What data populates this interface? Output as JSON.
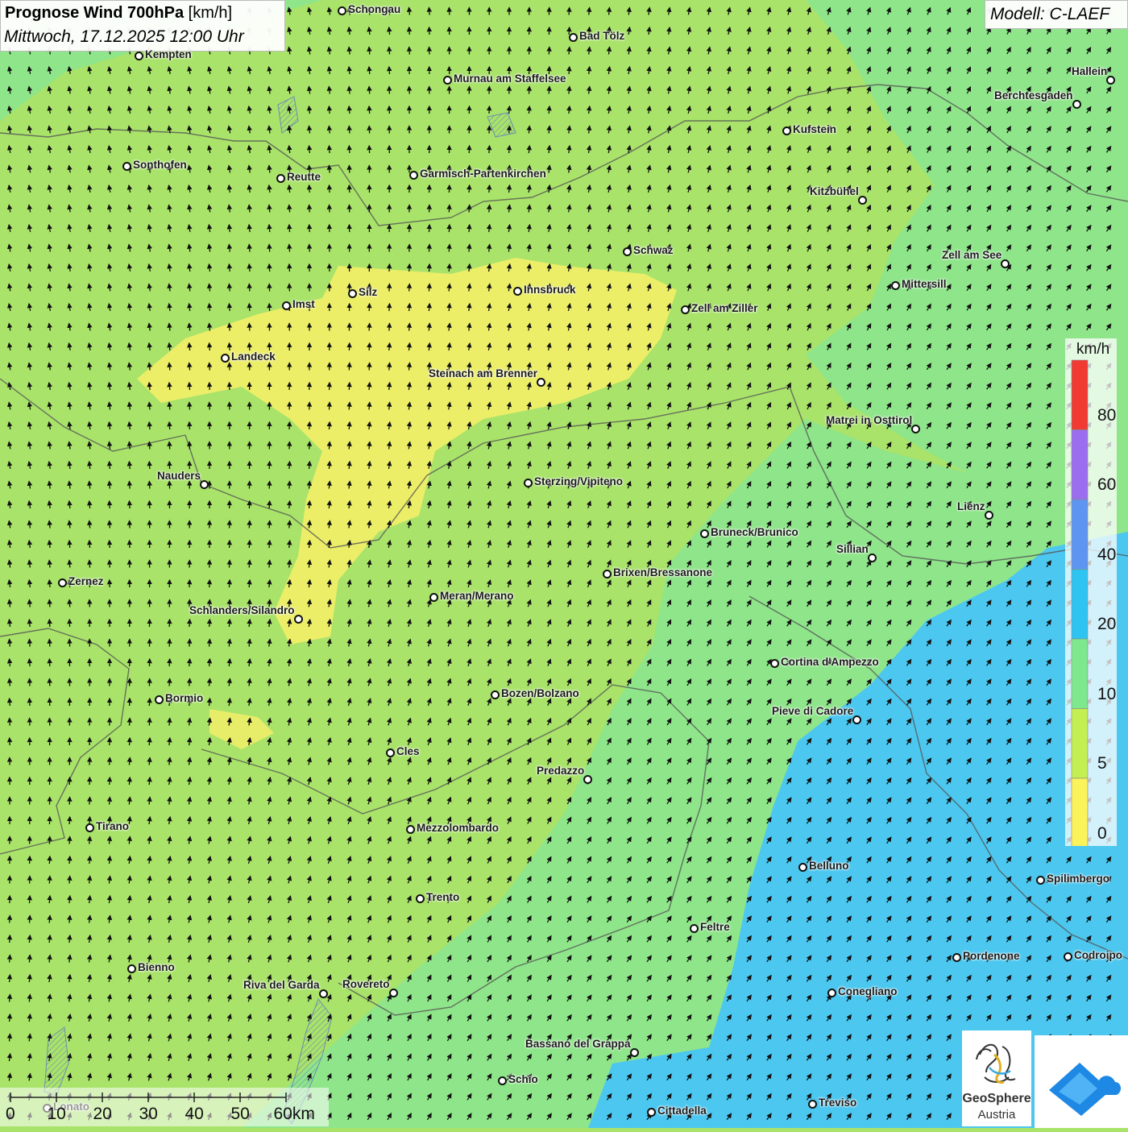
{
  "header": {
    "title_bold": "Prognose Wind 700hPa",
    "title_unit": "[km/h]",
    "subtitle": "Mittwoch, 17.12.2025 12:00 Uhr"
  },
  "model": {
    "label": "Modell: C-LAEF"
  },
  "legend": {
    "unit": "km/h",
    "labels": [
      "80",
      "60",
      "40",
      "20",
      "10",
      "5",
      "0"
    ],
    "colors": [
      "#f03a32",
      "#9b6ef0",
      "#5e95f2",
      "#2ec4f2",
      "#7de88e",
      "#c3ef52",
      "#fbf35a"
    ]
  },
  "scale_bar": {
    "labels": [
      "0",
      "10",
      "20",
      "30",
      "40",
      "50",
      "60km"
    ]
  },
  "cities": [
    {
      "name": "Schongau"
    },
    {
      "name": "Bad Tölz"
    },
    {
      "name": "Kempten"
    },
    {
      "name": "Hallein"
    },
    {
      "name": "Murnau am Staffelsee"
    },
    {
      "name": "Berchtesgaden"
    },
    {
      "name": "Kufstein"
    },
    {
      "name": "Sonthofen"
    },
    {
      "name": "Reutte"
    },
    {
      "name": "Garmisch-Partenkirchen"
    },
    {
      "name": "Kitzbühel"
    },
    {
      "name": "Schwaz"
    },
    {
      "name": "Zell am See"
    },
    {
      "name": "Mittersill"
    },
    {
      "name": "Silz"
    },
    {
      "name": "Innsbruck"
    },
    {
      "name": "Imst"
    },
    {
      "name": "Zell am Ziller"
    },
    {
      "name": "Landeck"
    },
    {
      "name": "Steinach am Brenner"
    },
    {
      "name": "Matrei in Osttirol"
    },
    {
      "name": "Nauders"
    },
    {
      "name": "Sterzing/Vipiteno"
    },
    {
      "name": "Lienz"
    },
    {
      "name": "Bruneck/Brunico"
    },
    {
      "name": "Sillian"
    },
    {
      "name": "Brixen/Bressanone"
    },
    {
      "name": "Zernez"
    },
    {
      "name": "Meran/Merano"
    },
    {
      "name": "Schlanders/Silandro"
    },
    {
      "name": "Cortina d'Ampezzo"
    },
    {
      "name": "Bozen/Bolzano"
    },
    {
      "name": "Bormio"
    },
    {
      "name": "Pieve di Cadore"
    },
    {
      "name": "Cles"
    },
    {
      "name": "Predazzo"
    },
    {
      "name": "Tirano"
    },
    {
      "name": "Mezzolombardo"
    },
    {
      "name": "Belluno"
    },
    {
      "name": "Spilimbergo"
    },
    {
      "name": "Trento"
    },
    {
      "name": "Feltre"
    },
    {
      "name": "Pordenone"
    },
    {
      "name": "Codroipo"
    },
    {
      "name": "Bienno"
    },
    {
      "name": "Riva del Garda"
    },
    {
      "name": "Rovereto"
    },
    {
      "name": "Conegliano"
    },
    {
      "name": "Bassano del Grappa"
    },
    {
      "name": "Schio"
    },
    {
      "name": "Treviso"
    },
    {
      "name": "Cittadella"
    },
    {
      "name": "Lonato"
    }
  ],
  "logos": {
    "geosphere_line1": "GeoSphere",
    "geosphere_line2": "Austria"
  }
}
